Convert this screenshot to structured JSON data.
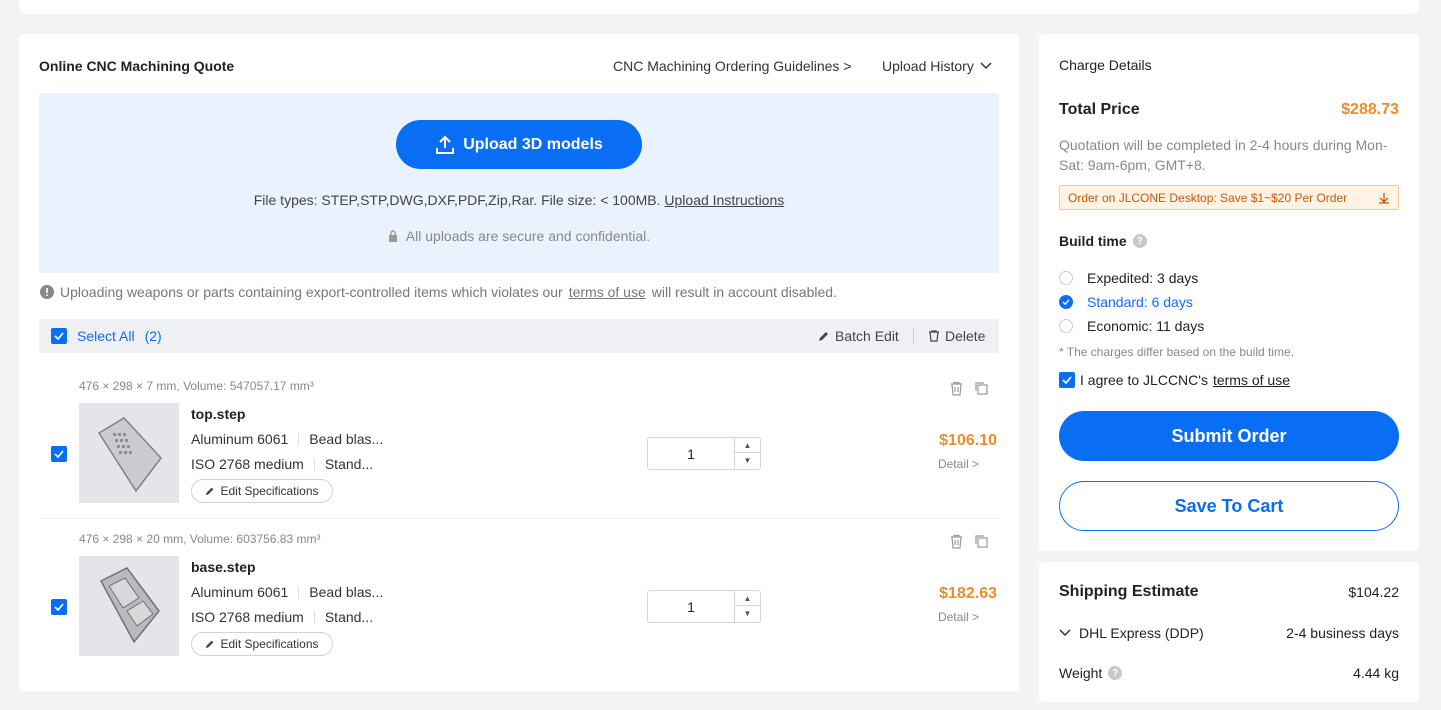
{
  "main": {
    "title": "Online CNC Machining Quote",
    "guidelines_link": "CNC Machining Ordering Guidelines >",
    "upload_history": "Upload History",
    "upload_button": "Upload 3D models",
    "file_types": "File types: STEP,STP,DWG,DXF,PDF,Zip,Rar. File size: < 100MB.",
    "upload_instructions": "Upload Instructions",
    "secure_note": "All uploads are secure and confidential.",
    "warning_before": "Uploading weapons or parts containing export-controlled items which violates our",
    "warning_terms": "terms of use",
    "warning_after": "will result in account disabled.",
    "select_all": "Select All",
    "select_count": "(2)",
    "batch_edit": "Batch Edit",
    "delete": "Delete",
    "items": [
      {
        "dims": "476 × 298 × 7 mm, Volume: 547057.17 mm³",
        "filename": "top.step",
        "material": "Aluminum 6061",
        "finish": "Bead blas...",
        "tolerance": "ISO 2768 medium",
        "extra": "Stand...",
        "edit_spec": "Edit Specifications",
        "qty": "1",
        "price": "$106.10",
        "detail": "Detail >"
      },
      {
        "dims": "476 × 298 × 20 mm, Volume: 603756.83 mm³",
        "filename": "base.step",
        "material": "Aluminum 6061",
        "finish": "Bead blas...",
        "tolerance": "ISO 2768 medium",
        "extra": "Stand...",
        "edit_spec": "Edit Specifications",
        "qty": "1",
        "price": "$182.63",
        "detail": "Detail >"
      }
    ]
  },
  "charge": {
    "title": "Charge Details",
    "total_label": "Total Price",
    "total_value": "$288.73",
    "quote_note": "Quotation will be completed in 2-4 hours during Mon-Sat: 9am-6pm, GMT+8.",
    "promo": "Order on JLCONE Desktop: Save $1~$20 Per Order",
    "build_time_label": "Build time",
    "options": [
      {
        "label": "Expedited: 3 days",
        "selected": false
      },
      {
        "label": "Standard: 6 days",
        "selected": true
      },
      {
        "label": "Economic: 11 days",
        "selected": false
      }
    ],
    "build_note": "* The charges differ based on the build time.",
    "agree_text": "I agree to JLCCNC's",
    "agree_terms": "terms of use",
    "submit": "Submit Order",
    "save_cart": "Save To Cart"
  },
  "shipping": {
    "title": "Shipping Estimate",
    "value": "$104.22",
    "method": "DHL Express (DDP)",
    "days": "2-4 business days",
    "weight_label": "Weight",
    "weight_value": "4.44 kg"
  },
  "colors": {
    "accent": "#0a6ef5",
    "price": "#f08c28"
  }
}
